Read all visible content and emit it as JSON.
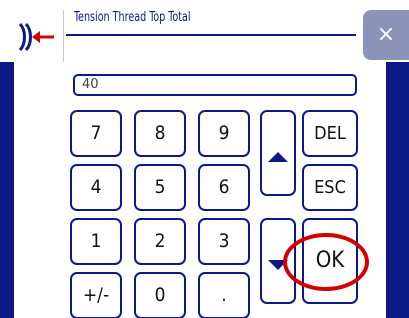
{
  "header": {
    "title": "Tension Thread Top Total",
    "back_icon": "back-arrow-icon",
    "close_label": "×",
    "close_icon": "close-icon"
  },
  "entry": {
    "value": "40"
  },
  "keypad": {
    "digits": [
      "7",
      "8",
      "9",
      "4",
      "5",
      "6",
      "1",
      "2",
      "3",
      "+/-",
      "0",
      "."
    ],
    "del_label": "DEL",
    "esc_label": "ESC",
    "ok_label": "OK",
    "up_icon": "arrow-up-icon",
    "down_icon": "arrow-down-icon"
  },
  "colors": {
    "navy": "#0b1a86",
    "close_bg": "#8c93b8",
    "highlight": "#d40000",
    "back_arrow": "#d40000"
  }
}
